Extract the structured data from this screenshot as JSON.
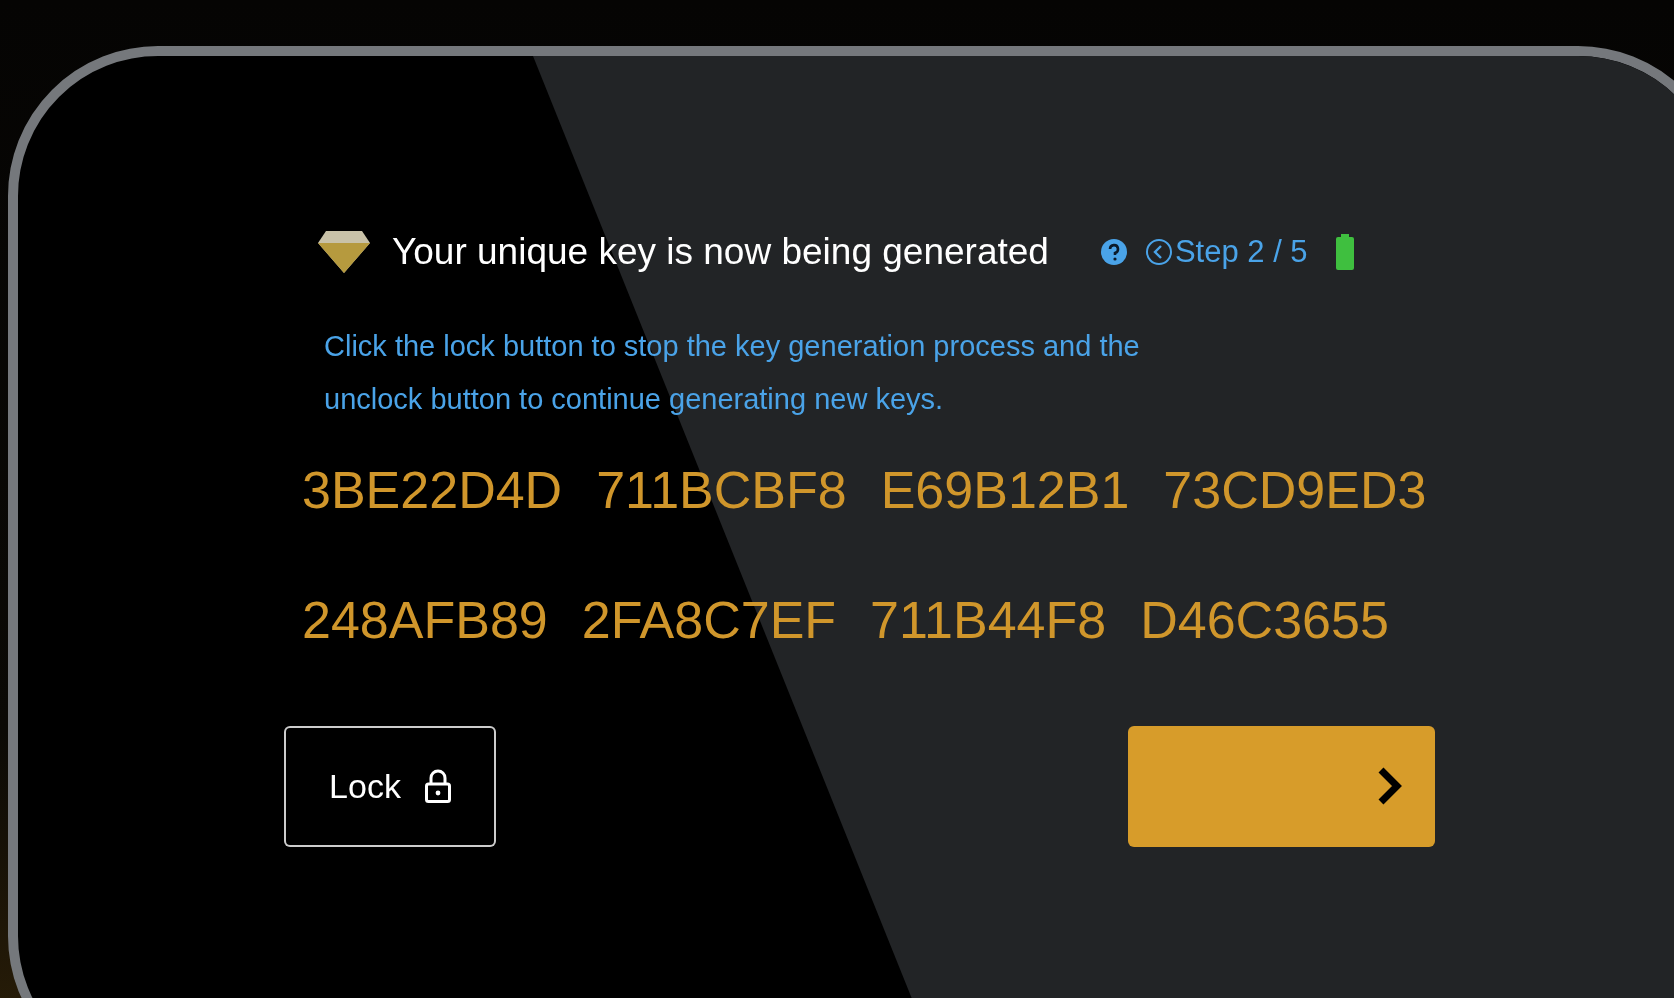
{
  "header": {
    "title": "Your unique key is now being generated",
    "step": "Step 2 / 5"
  },
  "instructions": "Click the lock button to stop the key generation process and the unclock button to continue generating new keys.",
  "keys": [
    [
      "3BE22D4D",
      "711BCBF8",
      "E69B12B1",
      "73CD9ED3"
    ],
    [
      "248AFB89",
      "2FA8C7EF",
      "711B44F8",
      "D46C3655"
    ]
  ],
  "lock_button": {
    "label": "Lock"
  }
}
